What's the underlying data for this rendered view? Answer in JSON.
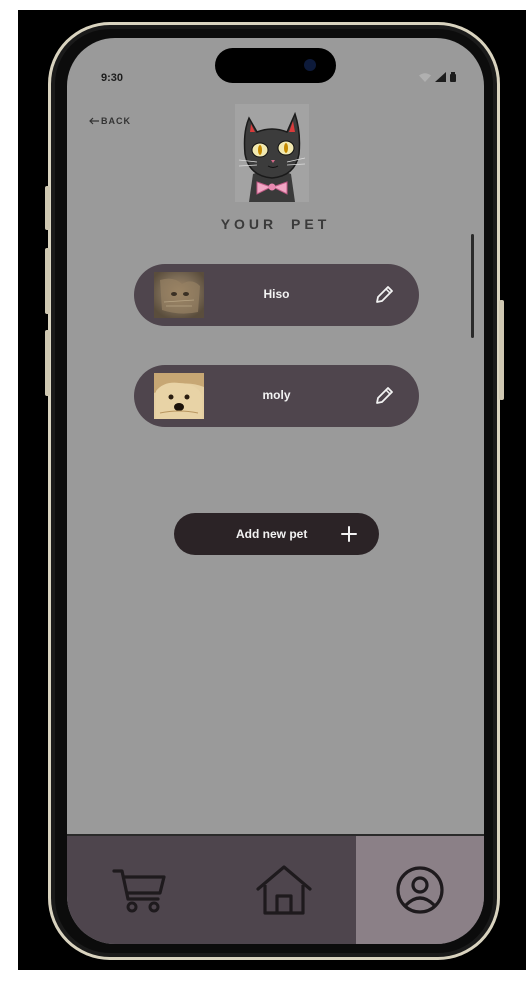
{
  "status_bar": {
    "time": "9:30"
  },
  "nav": {
    "back_label": "BACK"
  },
  "header": {
    "title": "YOUR PET"
  },
  "pets": [
    {
      "name": "Hiso"
    },
    {
      "name": "moly"
    }
  ],
  "actions": {
    "add_pet_label": "Add new pet"
  },
  "tabbar": {
    "tabs": [
      {
        "icon": "cart-icon",
        "active": false
      },
      {
        "icon": "home-icon",
        "active": false
      },
      {
        "icon": "profile-icon",
        "active": true
      }
    ]
  },
  "colors": {
    "screen_bg": "#9a9a9a",
    "card_bg": "#4f454d",
    "button_bg": "#2b2326",
    "tabbar_bg": "#4e454d",
    "tab_active_bg": "#8b8087"
  }
}
